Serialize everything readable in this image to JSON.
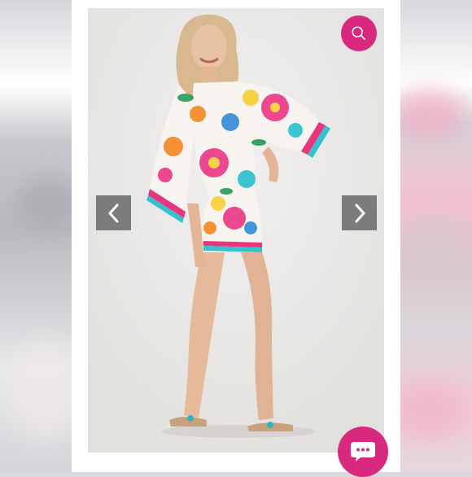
{
  "colors": {
    "accent": "#d8297f",
    "nav_button_bg": "#696969",
    "frame": "#ffffff"
  },
  "photo": {
    "subject": "model-wearing-floral-print-mini-dress-with-flutter-sleeves"
  },
  "controls": {
    "search_icon": "search-icon",
    "prev_icon": "chevron-left-icon",
    "next_icon": "chevron-right-icon",
    "chat_icon": "chat-bubble-icon"
  }
}
